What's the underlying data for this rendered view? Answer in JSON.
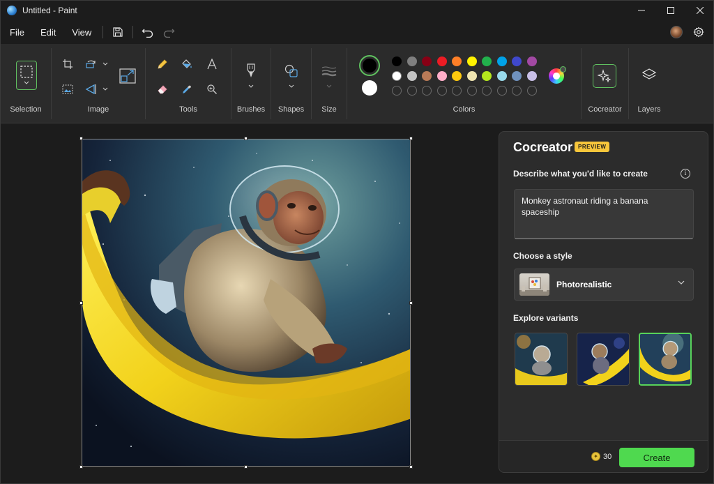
{
  "window": {
    "title": "Untitled - Paint",
    "controls": {
      "minimize": "–",
      "maximize": "□",
      "close": "✕"
    }
  },
  "menu": {
    "items": [
      "File",
      "Edit",
      "View"
    ],
    "icons": [
      "save-icon",
      "undo-icon",
      "redo-icon"
    ]
  },
  "ribbon": {
    "groups": {
      "selection": "Selection",
      "image": "Image",
      "tools": "Tools",
      "brushes": "Brushes",
      "shapes": "Shapes",
      "size": "Size",
      "colors": "Colors",
      "cocreator": "Cocreator",
      "layers": "Layers"
    },
    "colors": {
      "primary": "#000000",
      "secondary": "#ffffff",
      "row1": [
        "#000000",
        "#7f7f7f",
        "#880015",
        "#ed1c24",
        "#ff7f27",
        "#fff200",
        "#22b14c",
        "#00a2e8",
        "#3f48cc",
        "#a349a4"
      ],
      "row2": [
        "#ffffff",
        "#c3c3c3",
        "#b97a57",
        "#ffaec9",
        "#ffc90e",
        "#efe4b0",
        "#b5e61d",
        "#99d9ea",
        "#7092be",
        "#c8bfe7"
      ],
      "row3_count": 10
    }
  },
  "cocreator": {
    "title": "Cocreator",
    "badge": "PREVIEW",
    "describe_label": "Describe what you'd like to create",
    "prompt": "Monkey astronaut riding a banana spaceship",
    "style_label": "Choose a style",
    "style_value": "Photorealistic",
    "variants_label": "Explore variants",
    "selected_variant": 3,
    "credits": "30",
    "create_label": "Create"
  }
}
